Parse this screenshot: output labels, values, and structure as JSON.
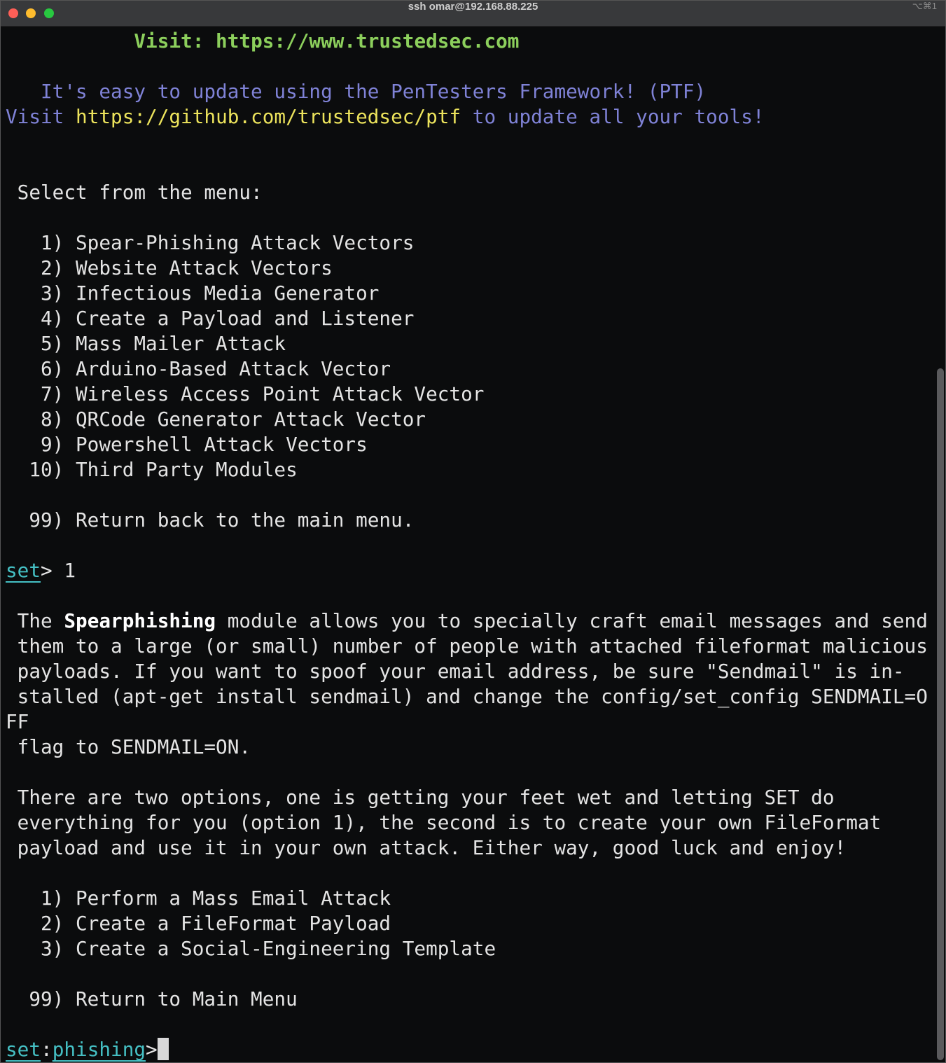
{
  "window": {
    "title": "ssh omar@192.168.88.225",
    "shortcut": "⌥⌘1",
    "scroll_position_percent": 100
  },
  "colors": {
    "green": "#8ccf5c",
    "blue": "#7f82d6",
    "yellow": "#ece35c",
    "cyan": "#45c0c4",
    "text": "#e4e4e4",
    "background": "#0b0c0d"
  },
  "terminal": {
    "lines": [
      [
        {
          "t": "           "
        },
        {
          "t": "Visit: https://www.trustedsec.com",
          "c": "green"
        }
      ],
      [],
      [
        {
          "t": "   It's easy to update using the PenTesters Framework! (PTF)",
          "c": "blue"
        }
      ],
      [
        {
          "t": "Visit ",
          "c": "blue"
        },
        {
          "t": "https://github.com/trustedsec/ptf",
          "c": "yellow"
        },
        {
          "t": " to update all your tools!",
          "c": "blue"
        }
      ],
      [],
      [],
      [
        {
          "t": " Select from the menu:"
        }
      ],
      [],
      [
        {
          "t": "   1) Spear-Phishing Attack Vectors"
        }
      ],
      [
        {
          "t": "   2) Website Attack Vectors"
        }
      ],
      [
        {
          "t": "   3) Infectious Media Generator"
        }
      ],
      [
        {
          "t": "   4) Create a Payload and Listener"
        }
      ],
      [
        {
          "t": "   5) Mass Mailer Attack"
        }
      ],
      [
        {
          "t": "   6) Arduino-Based Attack Vector"
        }
      ],
      [
        {
          "t": "   7) Wireless Access Point Attack Vector"
        }
      ],
      [
        {
          "t": "   8) QRCode Generator Attack Vector"
        }
      ],
      [
        {
          "t": "   9) Powershell Attack Vectors"
        }
      ],
      [
        {
          "t": "  10) Third Party Modules"
        }
      ],
      [],
      [
        {
          "t": "  99) Return back to the main menu."
        }
      ],
      [],
      [
        {
          "t": "set",
          "c": "cyan"
        },
        {
          "t": "> 1"
        }
      ],
      [],
      [
        {
          "t": " The "
        },
        {
          "t": "Spearphishing",
          "c": "bold"
        },
        {
          "t": " module allows you to specially craft email messages and send"
        }
      ],
      [
        {
          "t": " them to a large (or small) number of people with attached fileformat malicious"
        }
      ],
      [
        {
          "t": " payloads. If you want to spoof your email address, be sure \"Sendmail\" is in-"
        }
      ],
      [
        {
          "t": " stalled (apt-get install sendmail) and change the config/set_config SENDMAIL=O"
        }
      ],
      [
        {
          "t": "FF"
        }
      ],
      [
        {
          "t": " flag to SENDMAIL=ON."
        }
      ],
      [],
      [
        {
          "t": " There are two options, one is getting your feet wet and letting SET do"
        }
      ],
      [
        {
          "t": " everything for you (option 1), the second is to create your own FileFormat"
        }
      ],
      [
        {
          "t": " payload and use it in your own attack. Either way, good luck and enjoy!"
        }
      ],
      [],
      [
        {
          "t": "   1) Perform a Mass Email Attack"
        }
      ],
      [
        {
          "t": "   2) Create a FileFormat Payload"
        }
      ],
      [
        {
          "t": "   3) Create a Social-Engineering Template"
        }
      ],
      [],
      [
        {
          "t": "  99) Return to Main Menu"
        }
      ],
      [],
      [
        {
          "t": "set",
          "c": "cyan"
        },
        {
          "t": ":"
        },
        {
          "t": "phishing",
          "c": "cyan"
        },
        {
          "t": ">"
        },
        {
          "cursor": true
        }
      ]
    ]
  }
}
